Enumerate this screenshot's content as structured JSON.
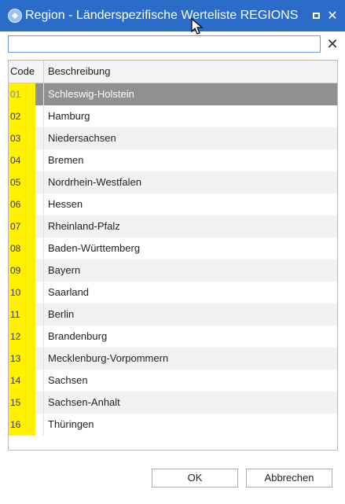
{
  "window": {
    "title": "Region - Länderspezifische Werteliste REGIONS",
    "icon": "region-icon"
  },
  "filter": {
    "value": "",
    "placeholder": "",
    "clear_icon": "close-icon"
  },
  "grid": {
    "columns": [
      "Code",
      "Beschreibung"
    ],
    "rows": [
      {
        "code": "01",
        "label": "Schleswig-Holstein"
      },
      {
        "code": "02",
        "label": "Hamburg"
      },
      {
        "code": "03",
        "label": "Niedersachsen"
      },
      {
        "code": "04",
        "label": "Bremen"
      },
      {
        "code": "05",
        "label": "Nordrhein-Westfalen"
      },
      {
        "code": "06",
        "label": "Hessen"
      },
      {
        "code": "07",
        "label": "Rheinland-Pfalz"
      },
      {
        "code": "08",
        "label": "Baden-Württemberg"
      },
      {
        "code": "09",
        "label": "Bayern"
      },
      {
        "code": "10",
        "label": "Saarland"
      },
      {
        "code": "11",
        "label": "Berlin"
      },
      {
        "code": "12",
        "label": "Brandenburg"
      },
      {
        "code": "13",
        "label": "Mecklenburg-Vorpommern"
      },
      {
        "code": "14",
        "label": "Sachsen"
      },
      {
        "code": "15",
        "label": "Sachsen-Anhalt"
      },
      {
        "code": "16",
        "label": "Thüringen"
      }
    ],
    "selected_code": "01"
  },
  "buttons": {
    "ok": "OK",
    "cancel": "Abbrechen"
  },
  "colors": {
    "titlebar": "#2b6cc9",
    "code_highlight": "#fff100",
    "selected_row": "#909090"
  }
}
